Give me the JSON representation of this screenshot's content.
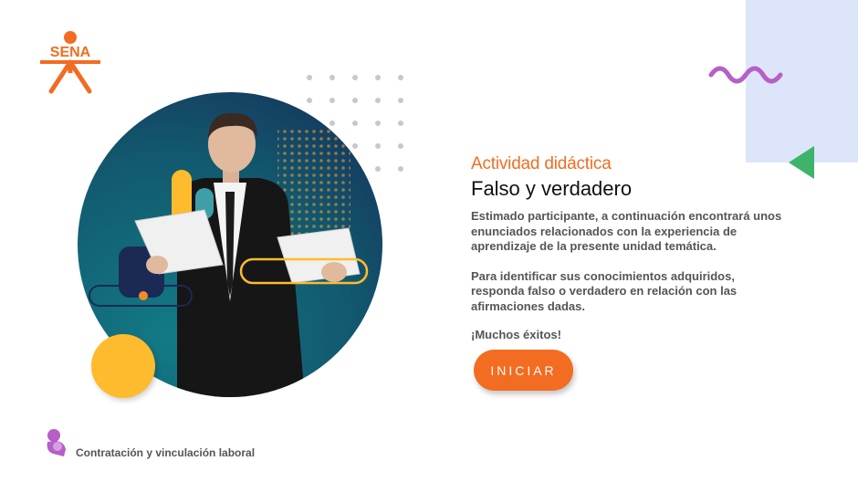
{
  "logo": {
    "text": "SENA",
    "icon": "sena-logo-icon"
  },
  "content": {
    "subtitle": "Actividad didáctica",
    "title": "Falso y verdadero",
    "paragraph1": "Estimado participante, a continuación encontrará unos enunciados relacionados con la experiencia de aprendizaje de la presente unidad temática.",
    "paragraph2": "Para identificar sus conocimientos adquiridos, responda falso o verdadero en relación con las afirmaciones dadas.",
    "closing": "¡Muchos éxitos!"
  },
  "start_button": {
    "label": "INICIAR"
  },
  "footer": {
    "label": "Contratación y vinculación laboral",
    "icon": "course-topic-icon"
  },
  "colors": {
    "accent": "#f26c21",
    "yellow": "#fdbb2d",
    "purple": "#b65fc6",
    "green": "#3db36b",
    "light_blue": "#dde5fb"
  }
}
